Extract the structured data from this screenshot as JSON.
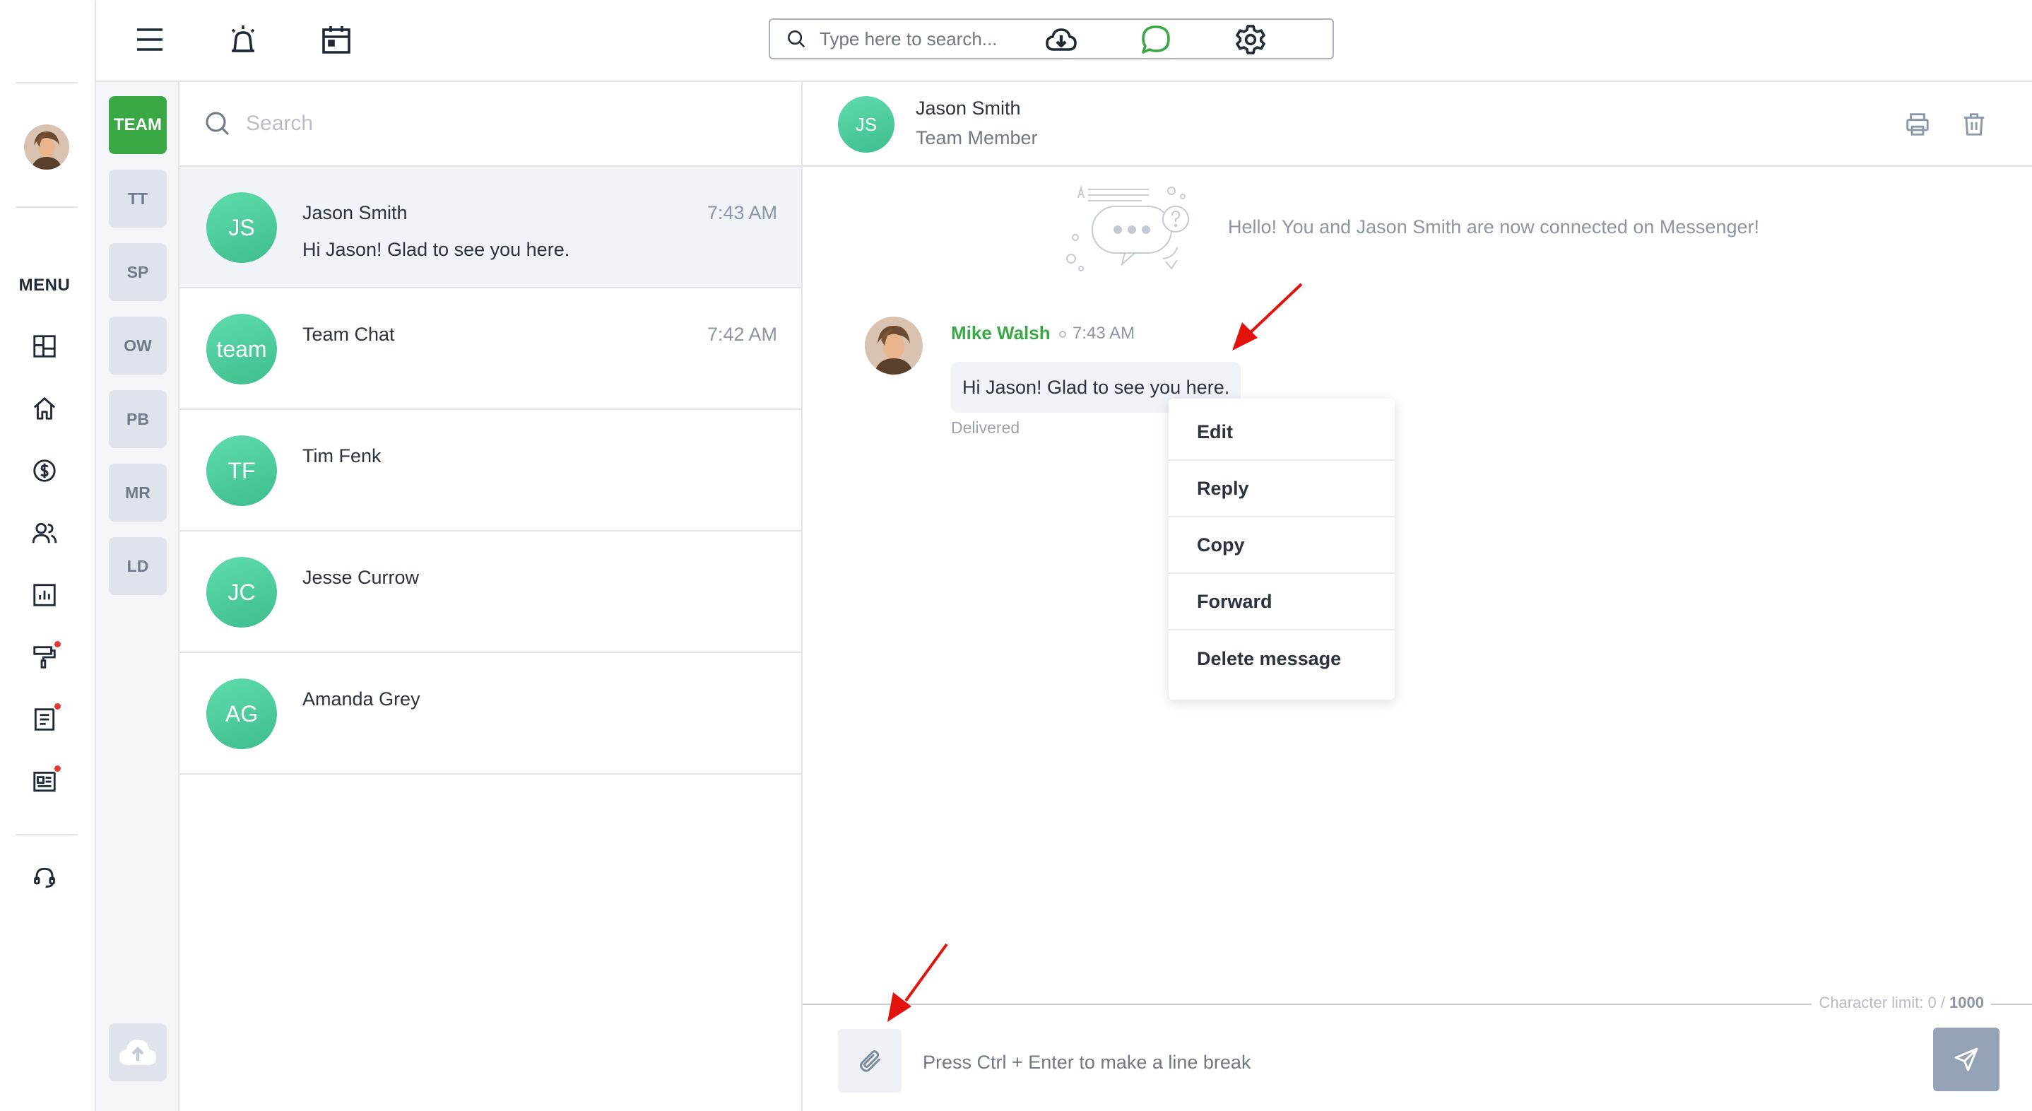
{
  "menu_label": "MENU",
  "top_bar": {
    "search_placeholder": "Type here to search..."
  },
  "channels": [
    {
      "label": "TEAM",
      "active": true
    },
    {
      "label": "TT"
    },
    {
      "label": "SP"
    },
    {
      "label": "OW"
    },
    {
      "label": "PB"
    },
    {
      "label": "MR"
    },
    {
      "label": "LD"
    }
  ],
  "conversation_list": {
    "search_placeholder": "Search",
    "items": [
      {
        "initials": "JS",
        "name": "Jason Smith",
        "time": "7:43 AM",
        "preview": "Hi Jason! Glad to see you here."
      },
      {
        "initials": "team",
        "name": "Team Chat",
        "time": "7:42 AM",
        "preview": ""
      },
      {
        "initials": "TF",
        "name": "Tim Fenk",
        "time": "",
        "preview": ""
      },
      {
        "initials": "JC",
        "name": "Jesse Currow",
        "time": "",
        "preview": ""
      },
      {
        "initials": "AG",
        "name": "Amanda Grey",
        "time": "",
        "preview": ""
      }
    ]
  },
  "chat": {
    "contact_initials": "JS",
    "contact_name": "Jason Smith",
    "contact_role": "Team Member",
    "connected_text": "Hello! You and Jason Smith are now connected on Messenger!",
    "message": {
      "sender": "Mike Walsh",
      "time": "7:43 AM",
      "text": "Hi Jason! Glad to see you here.",
      "status": "Delivered"
    },
    "context_menu": [
      "Edit",
      "Reply",
      "Copy",
      "Forward",
      "Delete message"
    ],
    "char_limit_label": "Character limit: 0 / ",
    "char_limit_max": "1000",
    "composer_placeholder": "Press Ctrl + Enter to make a line break"
  },
  "colors": {
    "accent_green": "#3aa845",
    "avatar_gradient": "#4ccf9c",
    "annotation_red": "#e3120b",
    "send_button": "#93a2b4"
  },
  "icons": {
    "top_bar": [
      "hamburger-menu-icon",
      "alarm-icon",
      "calendar-icon",
      "cloud-download-icon",
      "chat-bubble-icon",
      "gear-icon"
    ],
    "nav": [
      "dashboard-icon",
      "home-icon",
      "dollar-icon",
      "users-icon",
      "bar-chart-icon",
      "paint-roller-icon",
      "document-icon",
      "newspaper-icon",
      "headset-icon"
    ],
    "chat_header": [
      "printer-icon",
      "trash-icon"
    ],
    "composer": [
      "paperclip-icon",
      "send-icon"
    ]
  }
}
